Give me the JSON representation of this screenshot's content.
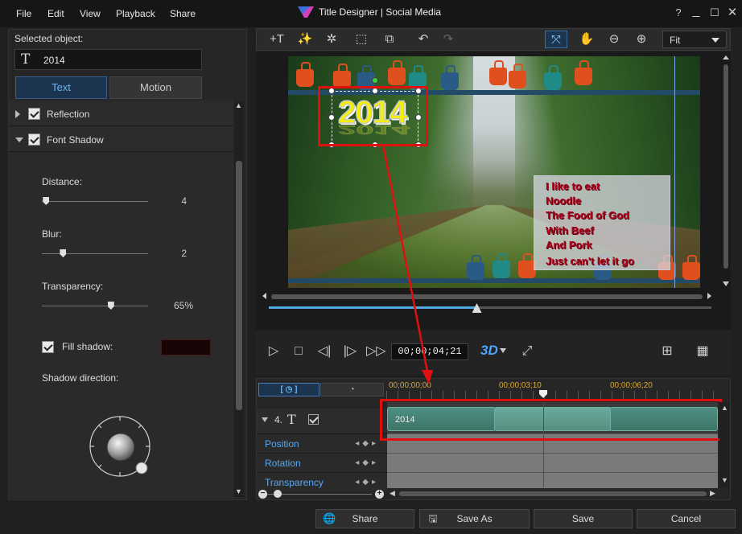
{
  "menu": {
    "items": [
      "File",
      "Edit",
      "View",
      "Playback",
      "Share"
    ]
  },
  "window": {
    "title": "Title Designer  |  Social Media"
  },
  "left_panel": {
    "selected_object_label": "Selected object:",
    "selected_object_value": "2014",
    "tabs": [
      {
        "label": "Text",
        "active": true
      },
      {
        "label": "Motion",
        "active": false
      }
    ],
    "sections": [
      {
        "label": "Reflection",
        "checked": true,
        "expanded": false
      },
      {
        "label": "Font Shadow",
        "checked": true,
        "expanded": true
      }
    ],
    "properties": {
      "distance": {
        "label": "Distance:",
        "value": "4",
        "fraction": 0.04
      },
      "blur": {
        "label": "Blur:",
        "value": "2",
        "fraction": 0.2
      },
      "transparency": {
        "label": "Transparency:",
        "value": "65%",
        "fraction": 0.65
      }
    },
    "fill_shadow": {
      "label": "Fill shadow:",
      "checked": true,
      "color": "#170404"
    },
    "shadow_direction_label": "Shadow direction:"
  },
  "toolbar": {
    "zoom_select": "Fit"
  },
  "preview": {
    "title_text": "2014",
    "lyrics": [
      "I like to eat",
      "Noodle",
      "The Food of God",
      "With Beef",
      "And Pork",
      "Just can't let it go"
    ],
    "seek_fraction": 0.47
  },
  "transport": {
    "timecode": "00;00;04;21",
    "three_d": "3D"
  },
  "timeline": {
    "ruler_labels": [
      "00;00;00;00",
      "00;00;03;10",
      "00;00;06;20"
    ],
    "track": {
      "number": "4.",
      "clip_label": "2014"
    },
    "keyframe_rows": [
      "Position",
      "Rotation",
      "Transparency"
    ]
  },
  "buttons": {
    "share": "Share",
    "save_as": "Save As",
    "save": "Save",
    "cancel": "Cancel"
  },
  "colors": {
    "accent_blue": "#6fb5ef",
    "highlight_red": "#e01010",
    "clip_teal": "#4e8f83",
    "title_yellow": "#f5f000",
    "lyric_red": "#b0001a"
  }
}
